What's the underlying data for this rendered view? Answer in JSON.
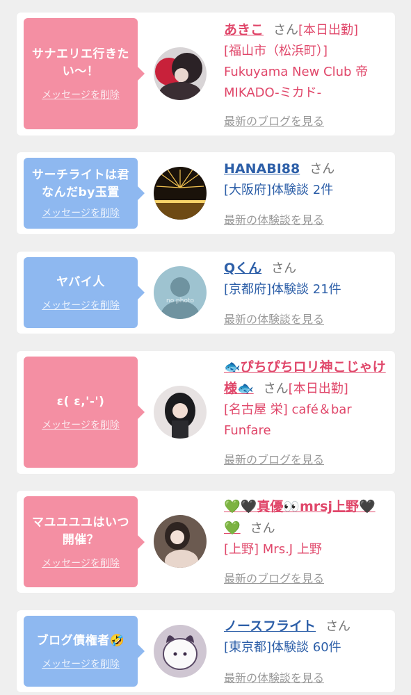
{
  "colors": {
    "pink": "#f48fa3",
    "blue": "#8eb8f0",
    "name_pink": "#e0476a",
    "name_blue": "#2d5fa8"
  },
  "delete_label": "メッセージを削除",
  "san_label": "さん",
  "entries": [
    {
      "message": "サナエリエ行きたい〜！",
      "name": "あきこ",
      "status": "[本日出勤]",
      "shop": "[福山市（松浜町）] Fukuyama New Club 帝 MIKADO-ミカド-",
      "link": "最新のブログを見る"
    },
    {
      "message": "サーチライトは君なんだby玉置",
      "name": "HANABI88",
      "status": "",
      "shop": "[大阪府]体験談 2件",
      "link": "最新の体験談を見る"
    },
    {
      "message": "ヤバイ人",
      "name": "Qくん",
      "status": "",
      "shop": "[京都府]体験談 21件",
      "link": "最新の体験談を見る",
      "avatar_text": "no photo"
    },
    {
      "message": "ε( ε,'-')",
      "name": "🐟ぴちぴちロリ神こじゃけ様🐟",
      "status": "[本日出勤]",
      "shop": "[名古屋 栄] café＆bar Funfare",
      "link": "最新のブログを見る"
    },
    {
      "message": "マユユユユはいつ開催？",
      "name": "💚🖤真優👀mrsj上野🖤💚",
      "status": "",
      "shop": "[上野] Mrs.J 上野",
      "link": "最新のブログを見る"
    },
    {
      "message": "ブログ債権者🤣",
      "name": "ノースフライト",
      "status": "",
      "shop": "[東京都]体験談 60件",
      "link": "最新の体験談を見る"
    }
  ]
}
